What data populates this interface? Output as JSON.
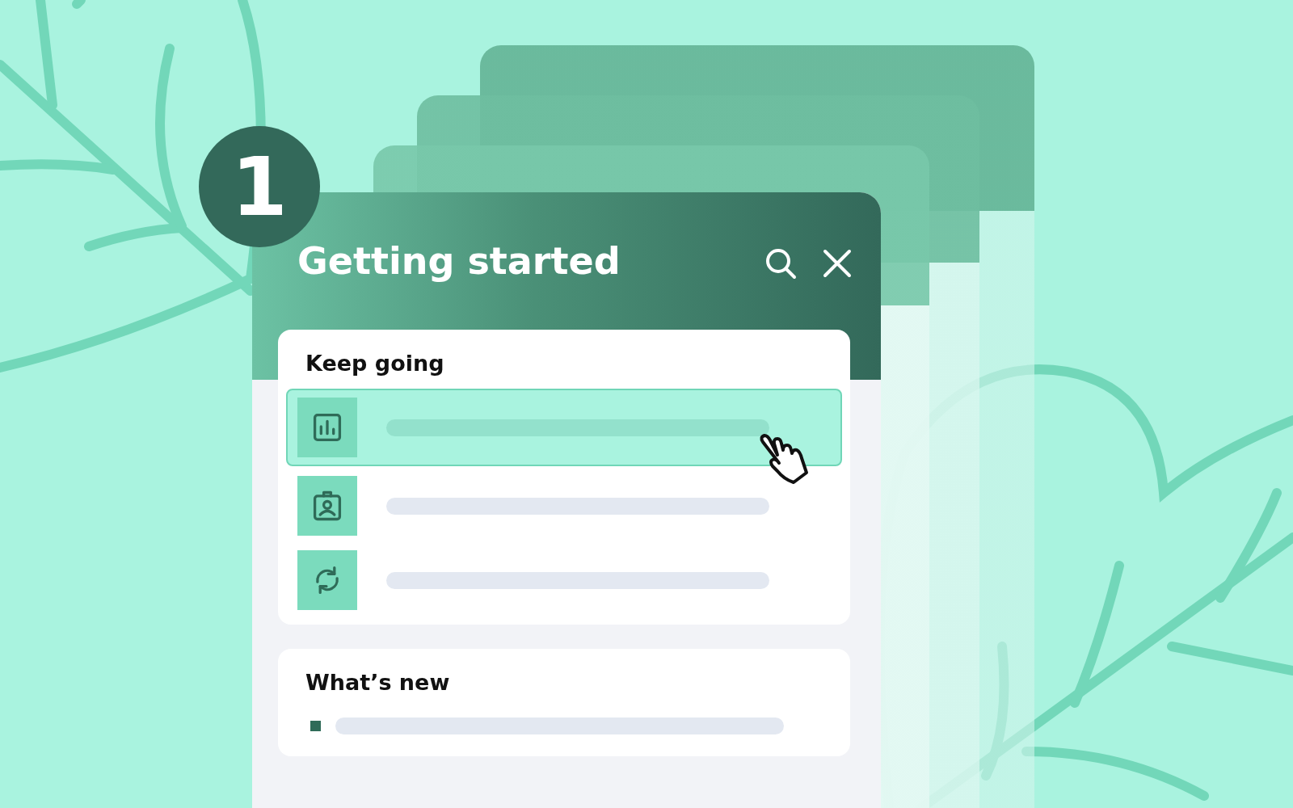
{
  "badge": {
    "number": "1"
  },
  "panel": {
    "title": "Getting started"
  },
  "sections": [
    {
      "kind": "tasks",
      "title": "Keep going",
      "items": [
        {
          "selected": true
        },
        {
          "selected": false
        },
        {
          "selected": false
        }
      ]
    },
    {
      "kind": "news",
      "title": "What’s new",
      "items": [
        {
          "selected": false
        }
      ]
    }
  ]
}
